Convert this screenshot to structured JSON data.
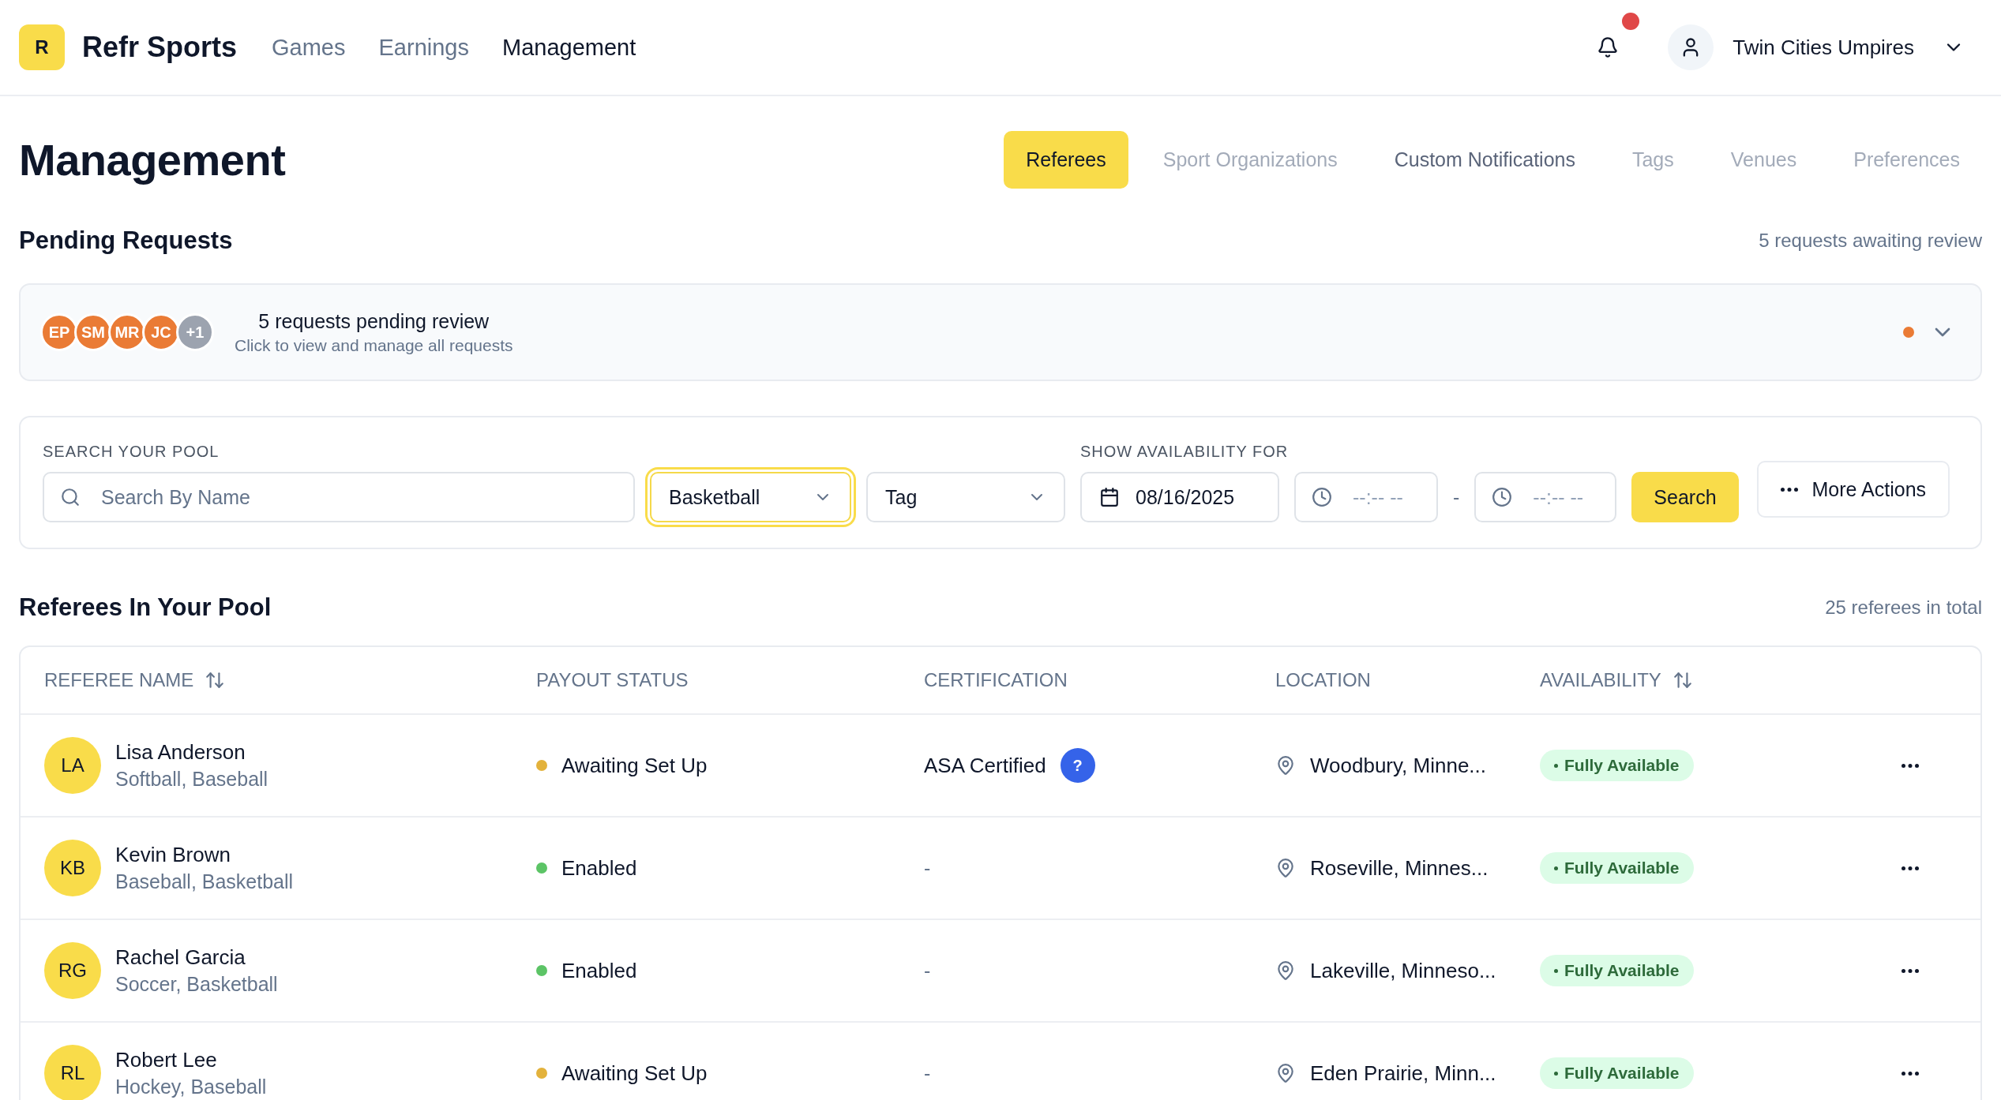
{
  "brand": {
    "logo_letter": "R",
    "name": "Refr Sports"
  },
  "nav": [
    {
      "label": "Games",
      "selected": false
    },
    {
      "label": "Earnings",
      "selected": false
    },
    {
      "label": "Management",
      "selected": true
    }
  ],
  "notifications": {
    "unread": true
  },
  "account": {
    "name": "Twin Cities Umpires"
  },
  "page_title": "Management",
  "tabs": [
    {
      "label": "Referees",
      "selected": true,
      "disabled": false
    },
    {
      "label": "Sport Organizations",
      "selected": false,
      "disabled": true
    },
    {
      "label": "Custom Notifications",
      "selected": false,
      "disabled": false
    },
    {
      "label": "Tags",
      "selected": false,
      "disabled": true
    },
    {
      "label": "Venues",
      "selected": false,
      "disabled": true
    },
    {
      "label": "Preferences",
      "selected": false,
      "disabled": true
    }
  ],
  "pending": {
    "title": "Pending Requests",
    "summary": "5 requests awaiting review",
    "headline": "5 requests pending review",
    "hint": "Click to view and manage all requests",
    "unread": true,
    "avatars": [
      {
        "initials": "EP",
        "kind": "person"
      },
      {
        "initials": "SM",
        "kind": "person"
      },
      {
        "initials": "MR",
        "kind": "person"
      },
      {
        "initials": "JC",
        "kind": "person"
      },
      {
        "initials": "+1",
        "kind": "more"
      }
    ]
  },
  "search": {
    "label": "SEARCH YOUR POOL",
    "placeholder": "Search By Name",
    "sport": {
      "value": "Basketball",
      "focused": true
    },
    "tag": {
      "value": "Tag",
      "focused": false
    },
    "availability_label": "SHOW AVAILABILITY FOR",
    "date": "08/16/2025",
    "start_time": {
      "placeholder": "--:-- --"
    },
    "separator": "-",
    "end_time": {
      "placeholder": "--:-- --"
    },
    "search_button": "Search",
    "more_button": "More Actions"
  },
  "pool": {
    "title": "Referees In Your Pool",
    "total": "25 referees in total"
  },
  "table": {
    "columns": [
      {
        "label": "REFEREE NAME",
        "sortable": true
      },
      {
        "label": "PAYOUT STATUS",
        "sortable": false
      },
      {
        "label": "CERTIFICATION",
        "sortable": false
      },
      {
        "label": "LOCATION",
        "sortable": false
      },
      {
        "label": "AVAILABILITY",
        "sortable": true
      }
    ],
    "rows": [
      {
        "initials": "LA",
        "name": "Lisa Anderson",
        "sports": "Softball, Baseball",
        "payout": {
          "label": "Awaiting Set Up",
          "color": "#e3b23c"
        },
        "certification": {
          "text": "ASA Certified",
          "help": "?"
        },
        "location": "Woodbury, Minne...",
        "availability": "Fully Available"
      },
      {
        "initials": "KB",
        "name": "Kevin Brown",
        "sports": "Baseball, Basketball",
        "payout": {
          "label": "Enabled",
          "color": "#5cc466"
        },
        "certification": {
          "text": "-"
        },
        "location": "Roseville, Minnes...",
        "availability": "Fully Available"
      },
      {
        "initials": "RG",
        "name": "Rachel Garcia",
        "sports": "Soccer, Basketball",
        "payout": {
          "label": "Enabled",
          "color": "#5cc466"
        },
        "certification": {
          "text": "-"
        },
        "location": "Lakeville, Minneso...",
        "availability": "Fully Available"
      },
      {
        "initials": "RL",
        "name": "Robert Lee",
        "sports": "Hockey, Baseball",
        "payout": {
          "label": "Awaiting Set Up",
          "color": "#e3b23c"
        },
        "certification": {
          "text": "-"
        },
        "location": "Eden Prairie, Minn...",
        "availability": "Fully Available"
      }
    ]
  }
}
